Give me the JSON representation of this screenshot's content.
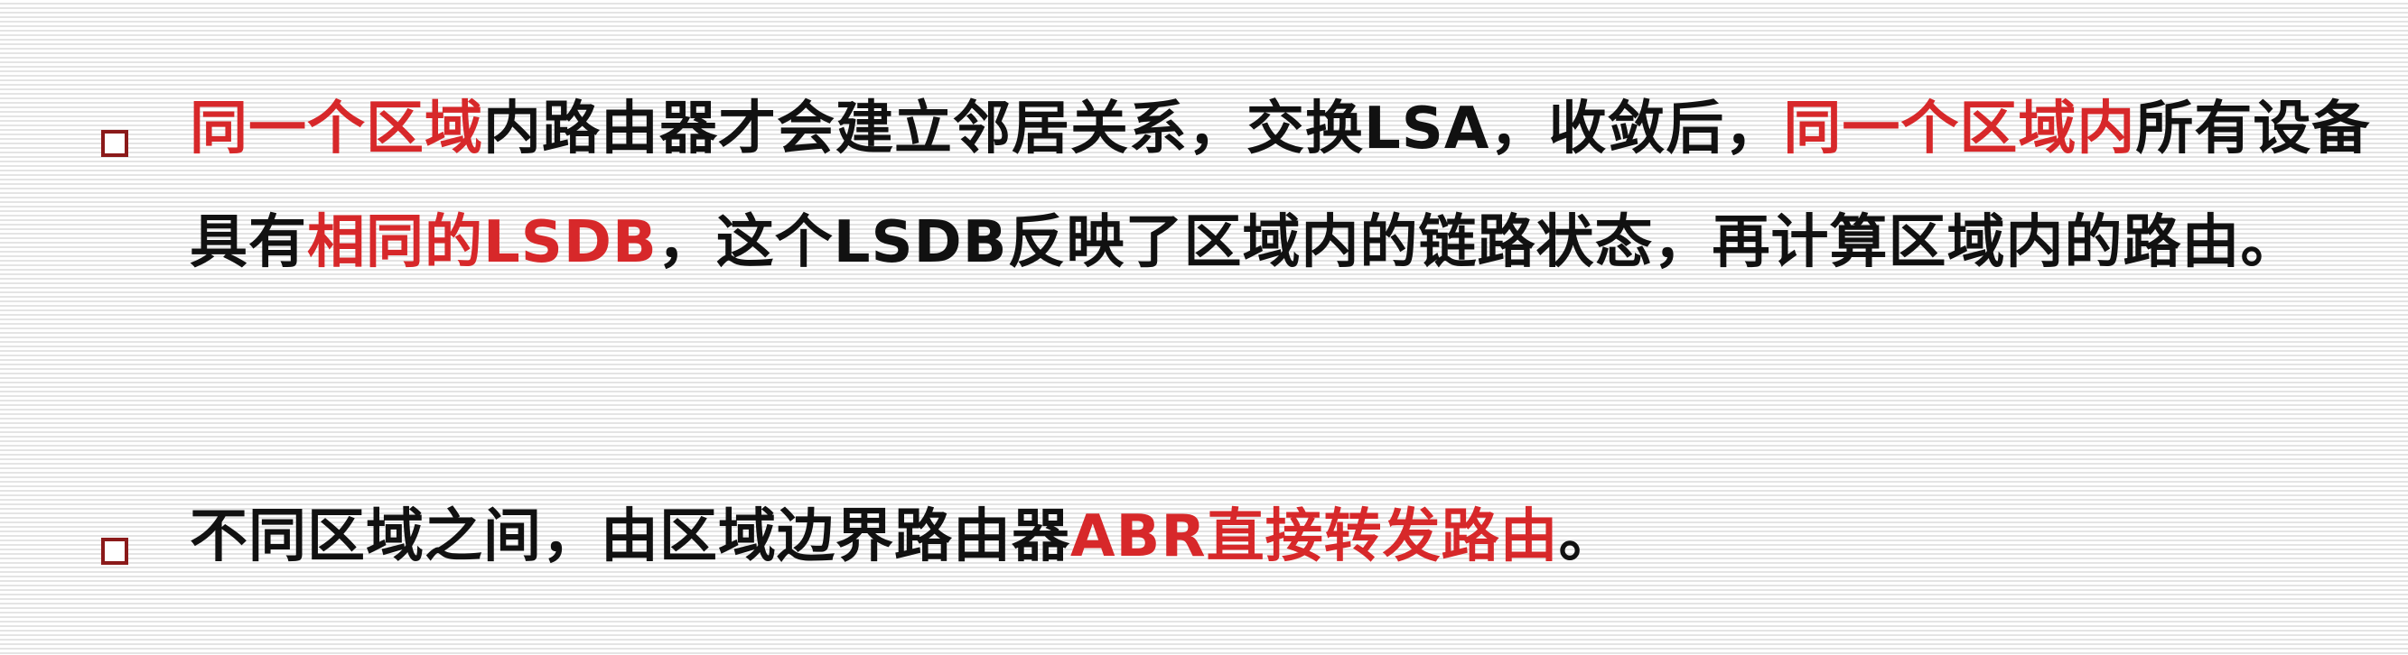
{
  "colors": {
    "highlight": "#d7282a",
    "text": "#111111",
    "bullet_border": "#8b1a1a"
  },
  "icons": {
    "bullet": "hollow-square-icon"
  },
  "bullets": [
    {
      "segments": [
        {
          "text": "同一个区域",
          "highlight": true
        },
        {
          "text": "内路由器才会建立邻居关系，交换LSA，收敛后，",
          "highlight": false
        },
        {
          "text": "同一个区域内",
          "highlight": true
        },
        {
          "text": "所有设备具有",
          "highlight": false
        },
        {
          "text": "相同的LSDB",
          "highlight": true
        },
        {
          "text": "，这个LSDB反映了区域内的链路状态，再计算区域内的路由。",
          "highlight": false
        }
      ]
    },
    {
      "segments": [
        {
          "text": "不同区域之间，由区域边界路由器",
          "highlight": false
        },
        {
          "text": "ABR直接转发路由",
          "highlight": true
        },
        {
          "text": "。",
          "highlight": false
        }
      ]
    }
  ]
}
